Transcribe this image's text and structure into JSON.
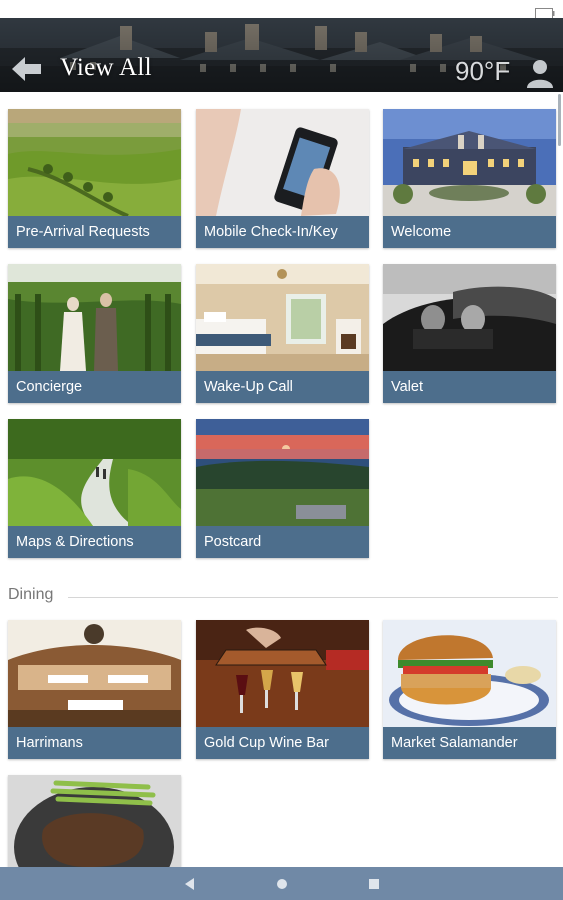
{
  "header": {
    "title": "View All",
    "temperature": "90°F",
    "icons": [
      "back-arrow-icon",
      "user-icon",
      "battery-icon"
    ]
  },
  "tiles_main": [
    {
      "label": "Pre-Arrival Requests"
    },
    {
      "label": "Mobile Check-In/Key"
    },
    {
      "label": "Welcome"
    },
    {
      "label": "Concierge"
    },
    {
      "label": "Wake-Up Call"
    },
    {
      "label": "Valet"
    },
    {
      "label": "Maps & Directions"
    },
    {
      "label": "Postcard"
    }
  ],
  "dining": {
    "title": "Dining",
    "tiles": [
      {
        "label": "Harrimans"
      },
      {
        "label": "Gold Cup Wine Bar"
      },
      {
        "label": "Market Salamander"
      },
      {
        "label": ""
      }
    ]
  },
  "navbar": {
    "icons": [
      "nav-back-icon",
      "nav-home-icon",
      "nav-recents-icon"
    ]
  },
  "colors": {
    "tile_label_bg": "#4d6e8c",
    "navbar_bg": "#7089a6"
  }
}
